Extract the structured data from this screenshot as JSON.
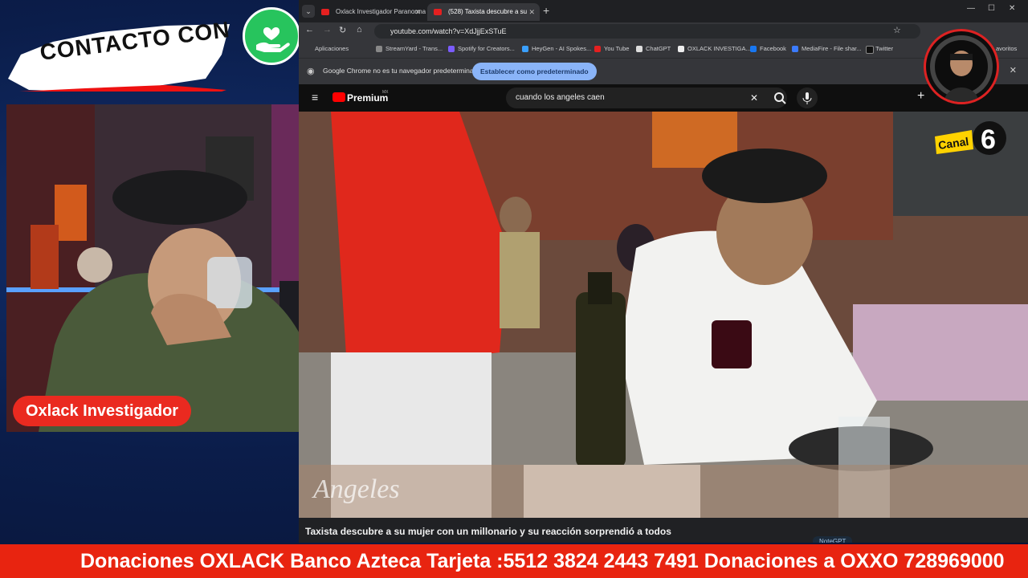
{
  "overlay": {
    "contacto_text": "CONTACTO CON",
    "channel_name": "Oxlack Investigador",
    "ticker": "Donaciones OXLACK Banco Azteca Tarjeta :5512 3824 2443 7491 Donaciones a OXXO 728969000"
  },
  "browser": {
    "tabs": [
      {
        "label": "Oxlack Investigador Paranormal",
        "active": false
      },
      {
        "label": "(528) Taxista descubre a su",
        "active": true
      }
    ],
    "address": "youtube.com/watch?v=XdJjjExSTuE",
    "bookmarks": [
      "Aplicaciones",
      "StreamYard - Trans...",
      "Spotify for Creators...",
      "HeyGen - AI Spokes...",
      "You Tube",
      "ChatGPT",
      "OXLACK INVESTIGA...",
      "Facebook",
      "MediaFire - File shar...",
      "Twitter",
      "avoritos"
    ],
    "infobar_text": "Google Chrome no es tu navegador predeterminado",
    "infobar_button": "Establecer como predeterminado"
  },
  "youtube": {
    "brand": "Premium",
    "brand_sup": "MX",
    "search_query": "cuando los angeles caen",
    "video_title": "Taxista descubre a su mujer con un millonario y su reacción sorprendió a todos",
    "watermark": "Angeles",
    "channel_badge": "Canal 6",
    "side_label": "NoteGPT"
  },
  "colors": {
    "ticker_red": "#e82410",
    "pill_red": "#ea2a20",
    "heart_green": "#27c45d",
    "chrome_blue": "#8ab4f8"
  }
}
